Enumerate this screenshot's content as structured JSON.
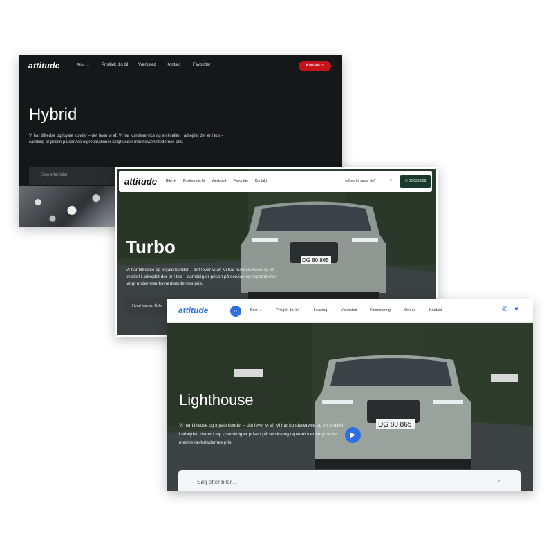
{
  "hybrid": {
    "logo": "attitude",
    "nav": [
      "Biler",
      "Prisitjek din bil",
      "Værksted",
      "Kontakt",
      "Favoritter"
    ],
    "cta": "Kontakt",
    "title": "Hybrid",
    "description": "Vi har tilfredse og loyale kunder – det lever vi af. Vi har kundeservice og en kvalitet i arbejdet der er i top – samtidig er prisen på service og reparationer langt under mærkeværkstedernes pris.",
    "search_placeholder": "Søg efter biler"
  },
  "turbo": {
    "logo": "attitude",
    "nav": [
      "Biler",
      "Prisitjek din bil",
      "Værksted",
      "Favoritter",
      "Kontakt"
    ],
    "search_placeholder": "Hvilken bil søger du?",
    "phone": "88 638 638",
    "title": "Turbo",
    "description": "Vi har tilfredse og loyale kunder – det lever vi af. Vi har kundeservice og en kvalitet i arbejdet der er i top – samtidig er prisen på service og reparationer langt under mærkeværkstedernes pris.",
    "button": "Hvad kan du få fo",
    "plate": "DG 80 865"
  },
  "lighthouse": {
    "logo": "attitude",
    "nav": [
      "Biler",
      "Pristjek din bil",
      "Leasing",
      "Værksted",
      "Finansiering",
      "Om os",
      "Kontakt"
    ],
    "title": "Lighthouse",
    "description": "Vi har tilfredse og loyale kunder – det lever vi af. Vi har kundeservice og en kvalitet i arbejdet, der er i top - samtidig er prisen på service og reparationer langt under mærkeværkstedernes pris.",
    "search_placeholder": "Søg efter biler...",
    "plate": "DG 80 865"
  },
  "colors": {
    "hybrid_accent": "#c4131b",
    "turbo_accent": "#173a2c",
    "lighthouse_accent": "#2d6fe0"
  }
}
